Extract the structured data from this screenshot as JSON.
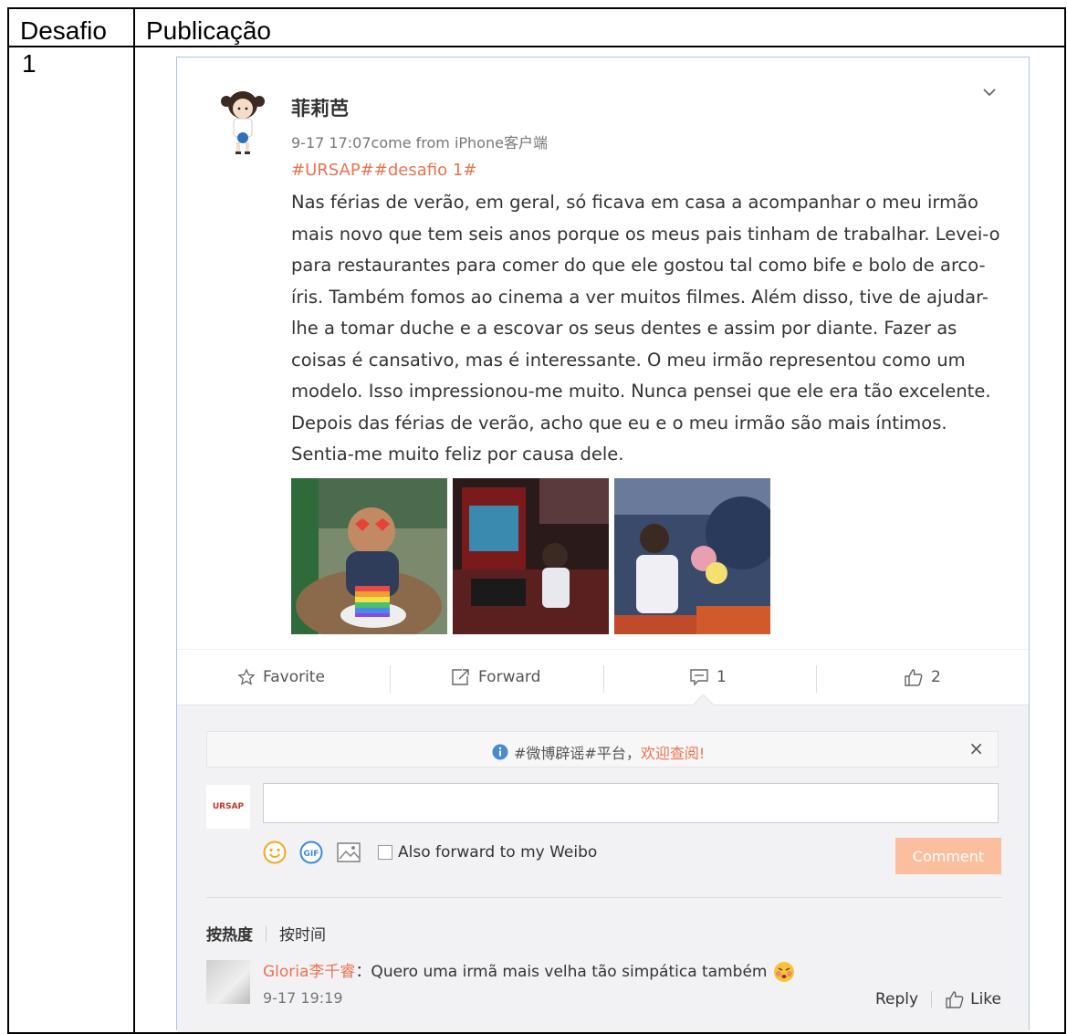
{
  "table": {
    "header_col1": "Desafio",
    "header_col2": "Publicação",
    "row1_num": "1"
  },
  "post": {
    "username": "菲莉芭",
    "time": "9-17 17:07",
    "source": "come from iPhone客户端",
    "hashtags": "#URSAP##desafio 1#",
    "text": "Nas férias de verão, em geral, só ficava em casa a acompanhar o meu irmão mais novo que tem seis anos porque os meus pais tinham de trabalhar. Levei-o para restaurantes para comer do que ele gostou tal como bife e bolo de arco-íris. Também fomos ao cinema a ver muitos filmes. Além disso, tive de ajudar-lhe a tomar duche e a escovar os seus dentes e assim por diante. Fazer as coisas é cansativo, mas é interessante. O meu irmão representou como um modelo. Isso impressionou-me muito. Nunca pensei que ele era tão excelente. Depois das férias de verão, acho que eu e o meu irmão são mais íntimos. Sentia-me muito feliz por causa dele.",
    "text_lines": [
      "Nas férias de verão, em geral, só ficava em casa a acompanhar o meu irmão",
      "mais novo que tem seis anos porque os meus pais tinham de trabalhar. Levei-o",
      "para restaurantes para comer do que ele gostou tal como bife e bolo de arco-",
      "íris. Também fomos ao cinema a ver muitos filmes. Além disso, tive de ajudar-",
      "lhe a tomar duche e a escovar os seus dentes e assim por diante. Fazer as",
      "coisas é cansativo, mas é interessante. O meu irmão representou como um",
      "modelo. Isso impressionou-me muito. Nunca pensei que ele era tão excelente.",
      "Depois das férias de verão, acho que eu e o meu irmão são mais íntimos.",
      "Sentia-me muito feliz por causa dele."
    ]
  },
  "actions": {
    "favorite": "Favorite",
    "forward": "Forward",
    "comments": "1",
    "likes": "2"
  },
  "comment_box": {
    "notice_tag": "#微博辟谣#平台，",
    "notice_link": "欢迎查阅!",
    "close": "×",
    "my_avatar": "URSAP",
    "forward_option": "Also forward to my Weibo",
    "submit": "Comment"
  },
  "sort": {
    "hot": "按热度",
    "time": "按时间"
  },
  "comment": {
    "user": "Gloria李千睿",
    "text": "：Quero uma irmã mais velha tão simpática também",
    "time": "9-17 19:19",
    "reply": "Reply",
    "like": "Like"
  },
  "colors": {
    "accent": "#eb7350",
    "comment_button": "#fbbe9f",
    "card_border": "#a9c6df"
  }
}
